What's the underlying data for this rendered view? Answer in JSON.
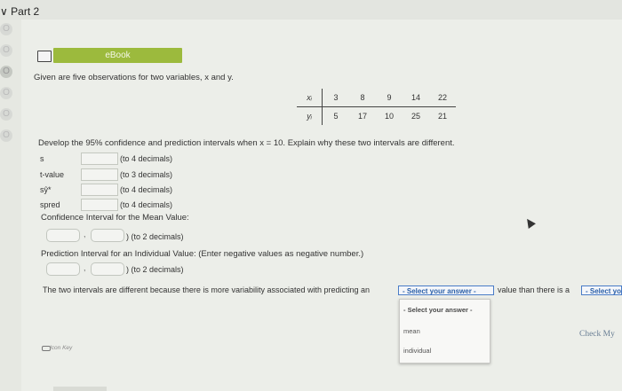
{
  "part_title": "Part 2",
  "radio_symbol": "O",
  "ebook": {
    "label": "eBook"
  },
  "intro": "Given are five observations for two variables, x and y.",
  "table": {
    "x_header": "xᵢ",
    "y_header": "yᵢ",
    "x_values": [
      "3",
      "8",
      "9",
      "14",
      "22"
    ],
    "y_values": [
      "5",
      "17",
      "10",
      "25",
      "21"
    ]
  },
  "question": "Develop the 95% confidence and prediction intervals when x = 10. Explain why these two intervals are different.",
  "fields": [
    {
      "label": "s",
      "hint": "(to 4 decimals)"
    },
    {
      "label": "t-value",
      "hint": "(to 3 decimals)"
    },
    {
      "label": "sŷ*",
      "hint": "(to 4 decimals)"
    },
    {
      "label": "spred",
      "hint": "(to 4 decimals)"
    }
  ],
  "ci_mean": {
    "title": "Confidence Interval for the Mean Value:",
    "hint": ") (to 2 decimals)"
  },
  "pi": {
    "title": "Prediction Interval for an Individual Value: (Enter negative values as negative number.)",
    "hint": ") (to 2 decimals)"
  },
  "comma": ",",
  "conclusion": {
    "prefix": "The two intervals are different because there is more variability associated with predicting an",
    "select1": "- Select your answer -",
    "middle": "value than there is a",
    "select2": "- Select yo"
  },
  "dropdown_options": [
    "- Select your answer -",
    "mean",
    "individual"
  ],
  "check_label": "Check My",
  "icon_key_label": "Icon Key",
  "colors": {
    "ebook_green": "#9cba3d",
    "select_blue": "#2a5fa8"
  }
}
